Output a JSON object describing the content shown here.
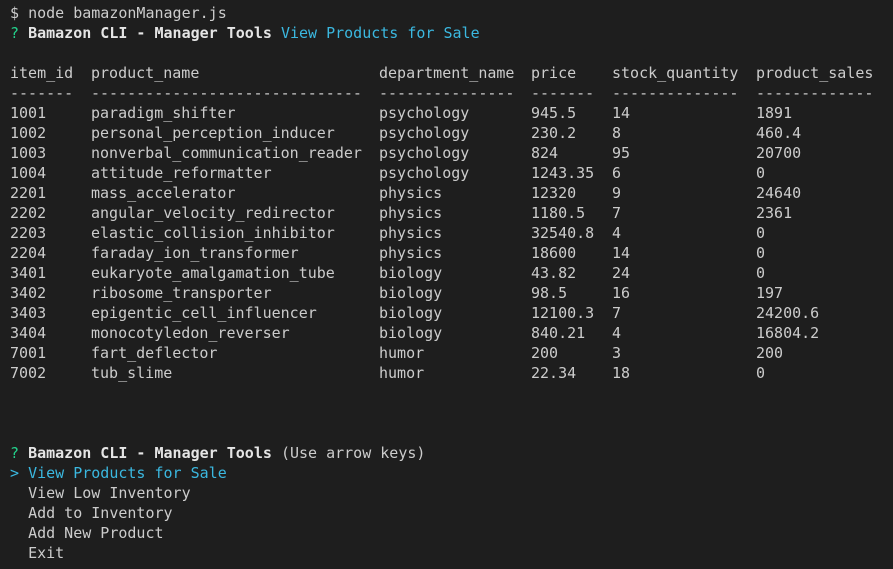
{
  "prompt_line": {
    "symbol": "$",
    "command": "node bamazonManager.js"
  },
  "answered_question": {
    "mark": "?",
    "label": "Bamazon CLI - Manager Tools",
    "answer": "View Products for Sale"
  },
  "table": {
    "headers": [
      "item_id",
      "product_name",
      "department_name",
      "price",
      "stock_quantity",
      "product_sales"
    ],
    "separators": [
      "-------",
      "------------------------------",
      "---------------",
      "-------",
      "--------------",
      "-------------"
    ],
    "rows": [
      [
        "1001",
        "paradigm_shifter",
        "psychology",
        "945.5",
        "14",
        "1891"
      ],
      [
        "1002",
        "personal_perception_inducer",
        "psychology",
        "230.2",
        "8",
        "460.4"
      ],
      [
        "1003",
        "nonverbal_communication_reader",
        "psychology",
        "824",
        "95",
        "20700"
      ],
      [
        "1004",
        "attitude_reformatter",
        "psychology",
        "1243.35",
        "6",
        "0"
      ],
      [
        "2201",
        "mass_accelerator",
        "physics",
        "12320",
        "9",
        "24640"
      ],
      [
        "2202",
        "angular_velocity_redirector",
        "physics",
        "1180.5",
        "7",
        "2361"
      ],
      [
        "2203",
        "elastic_collision_inhibitor",
        "physics",
        "32540.8",
        "4",
        "0"
      ],
      [
        "2204",
        "faraday_ion_transformer",
        "physics",
        "18600",
        "14",
        "0"
      ],
      [
        "3401",
        "eukaryote_amalgamation_tube",
        "biology",
        "43.82",
        "24",
        "0"
      ],
      [
        "3402",
        "ribosome_transporter",
        "biology",
        "98.5",
        "16",
        "197"
      ],
      [
        "3403",
        "epigentic_cell_influencer",
        "biology",
        "12100.3",
        "7",
        "24200.6"
      ],
      [
        "3404",
        "monocotyledon_reverser",
        "biology",
        "840.21",
        "4",
        "16804.2"
      ],
      [
        "7001",
        "fart_deflector",
        "humor",
        "200",
        "3",
        "200"
      ],
      [
        "7002",
        "tub_slime",
        "humor",
        "22.34",
        "18",
        "0"
      ]
    ]
  },
  "menu_question": {
    "mark": "?",
    "label": "Bamazon CLI - Manager Tools",
    "hint": "(Use arrow keys)",
    "pointer": ">",
    "options": [
      "View Products for Sale",
      "View Low Inventory",
      "Add to Inventory",
      "Add New Product",
      "Exit"
    ],
    "selected_index": 0
  },
  "colors": {
    "background": "#1e1e1e",
    "text": "#cccccc",
    "question_mark": "#23d18b",
    "highlight": "#3bb8e0"
  }
}
